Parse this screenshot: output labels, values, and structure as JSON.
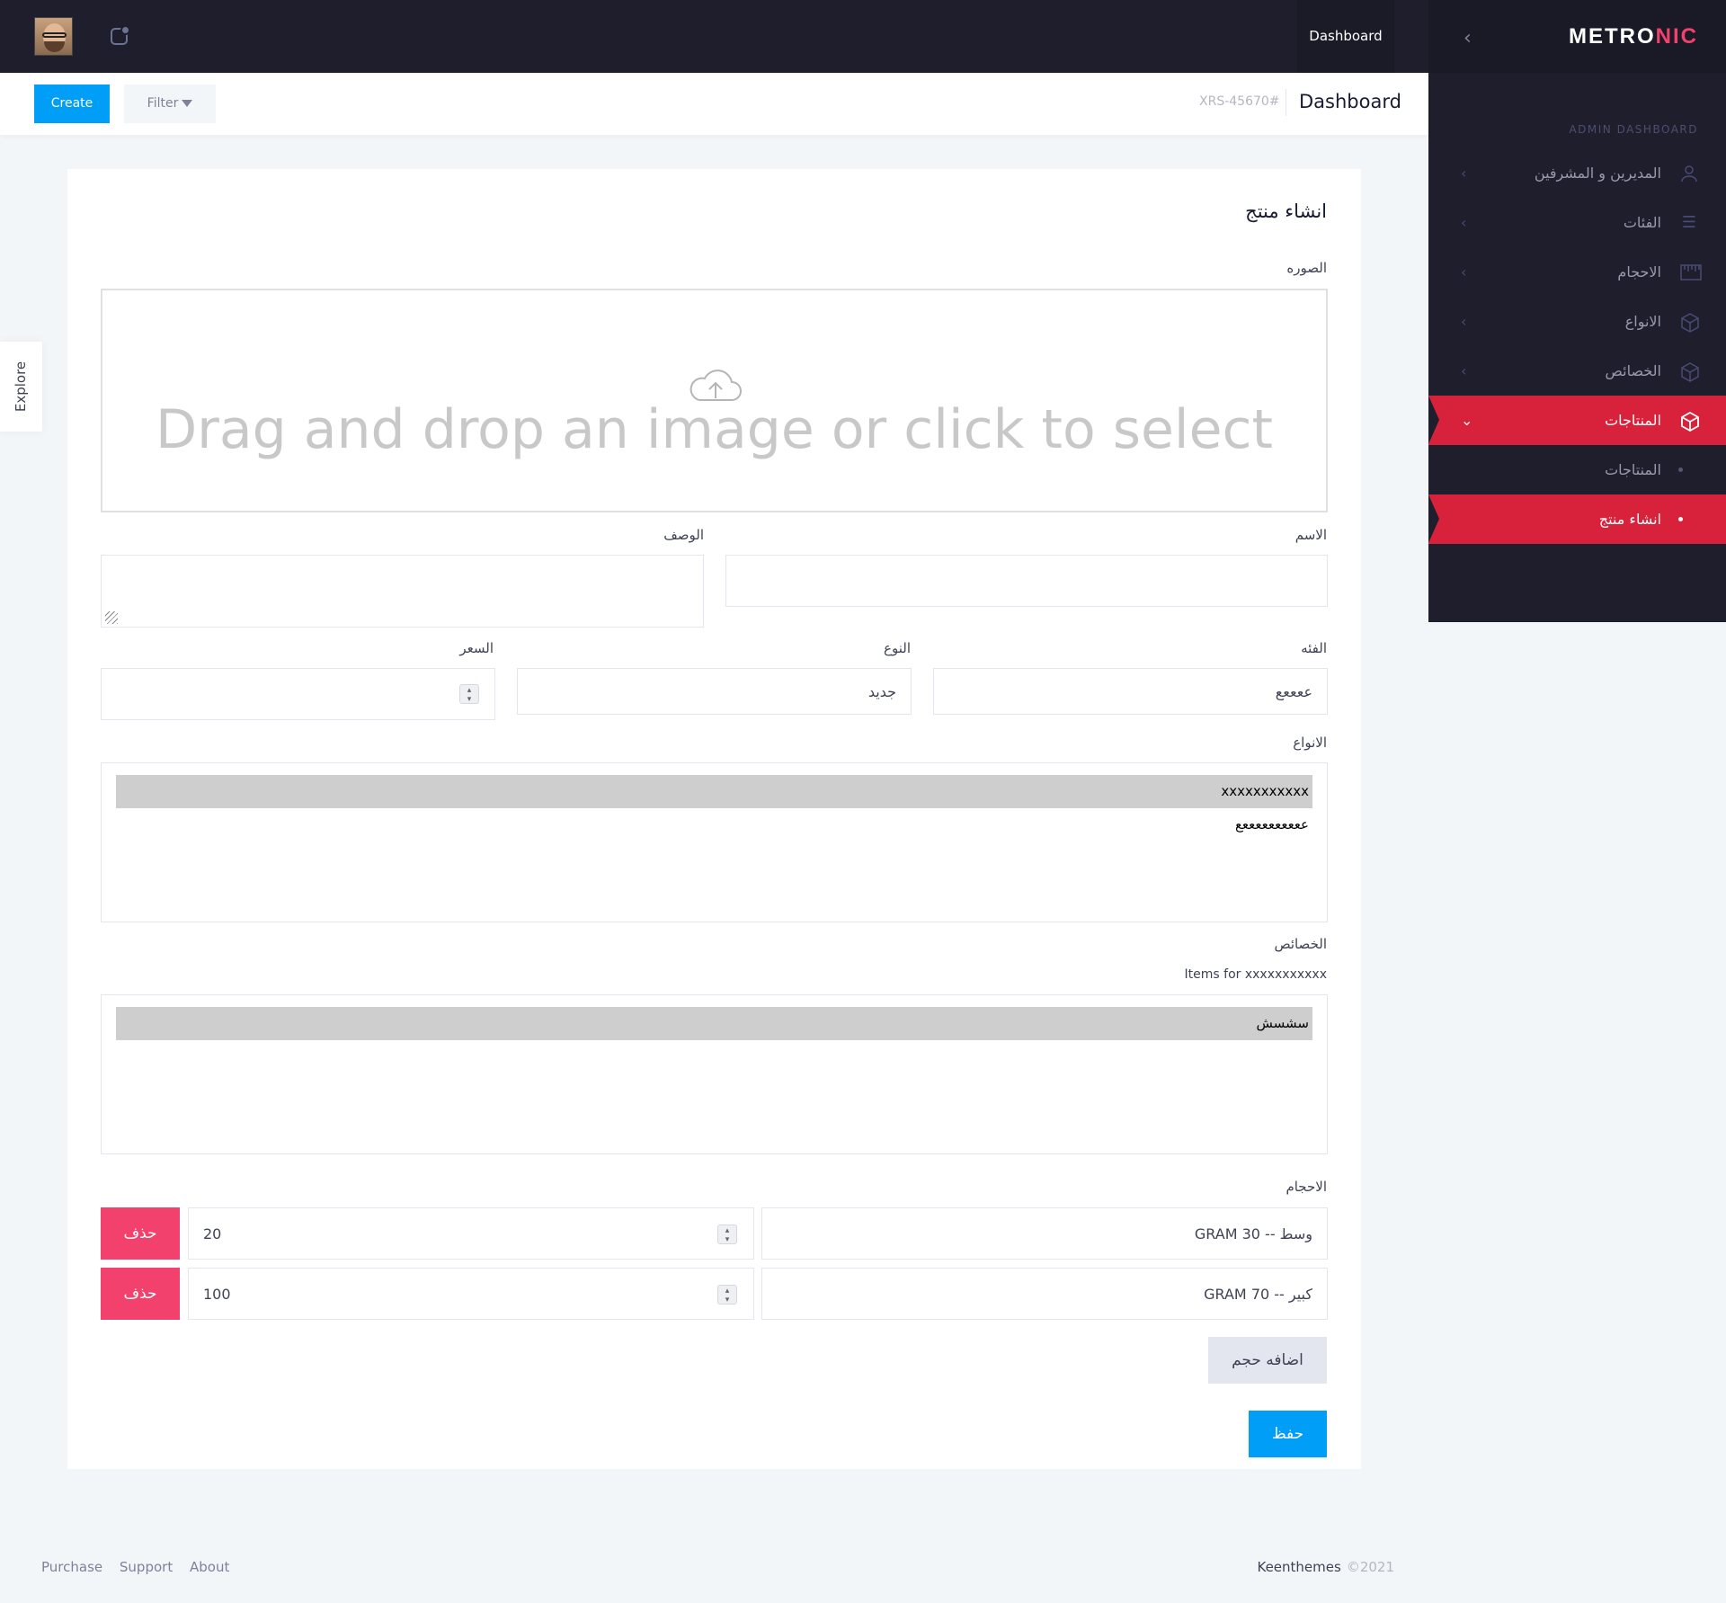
{
  "header": {
    "dashboard_tab": "Dashboard"
  },
  "sidebar": {
    "logo_main": "METRO",
    "logo_accent": "NIC",
    "section_title": "ADMIN DASHBOARD",
    "items": [
      {
        "label": "المديرين و المشرفين",
        "icon": "user-icon"
      },
      {
        "label": "الفئات",
        "icon": "list-icon"
      },
      {
        "label": "الاحجام",
        "icon": "ruler-icon"
      },
      {
        "label": "الانواع",
        "icon": "cube-icon"
      },
      {
        "label": "الخصائص",
        "icon": "cube-icon"
      },
      {
        "label": "المنتاجات",
        "icon": "cube-icon"
      }
    ],
    "subitems": [
      {
        "label": "المنتاجات"
      },
      {
        "label": "انشاء منتج"
      }
    ]
  },
  "subheader": {
    "create_label": "Create",
    "filter_label": "Filter",
    "code": "XRS-45670#",
    "title": "Dashboard"
  },
  "explore_label": "Explore",
  "form": {
    "title": "انشاء منتج",
    "image_label": "الصوره",
    "dropzone_text": "Drag and drop an image or click to select",
    "name_label": "الاسم",
    "name_value": "",
    "description_label": "الوصف",
    "description_value": "",
    "category_label": "الفئه",
    "category_value": "ععععع",
    "type_label": "النوع",
    "type_value": "جديد",
    "price_label": "السعر",
    "price_value": "",
    "types_label": "الانواع",
    "types_options": [
      "xxxxxxxxxxx",
      "ععععععععععع"
    ],
    "attributes_label": "الخصائص",
    "attributes_items_for": "Items for xxxxxxxxxxx",
    "attributes_options": [
      "سشسش"
    ],
    "sizes_label": "الاحجام",
    "sizes": [
      {
        "size": "وسط -- GRAM 30",
        "qty": "20",
        "delete_label": "حذف"
      },
      {
        "size": "كبير -- GRAM 70",
        "qty": "100",
        "delete_label": "حذف"
      }
    ],
    "add_size_label": "اضافه حجم",
    "save_label": "حفظ"
  },
  "footer": {
    "links": [
      "Purchase",
      "Support",
      "About"
    ],
    "brand": "Keenthemes",
    "year": "©2021"
  },
  "colors": {
    "dark_bg": "#1e1e2d",
    "accent_red": "#d8213b",
    "primary_blue": "#009ef7",
    "danger_pink": "#f1416c"
  }
}
